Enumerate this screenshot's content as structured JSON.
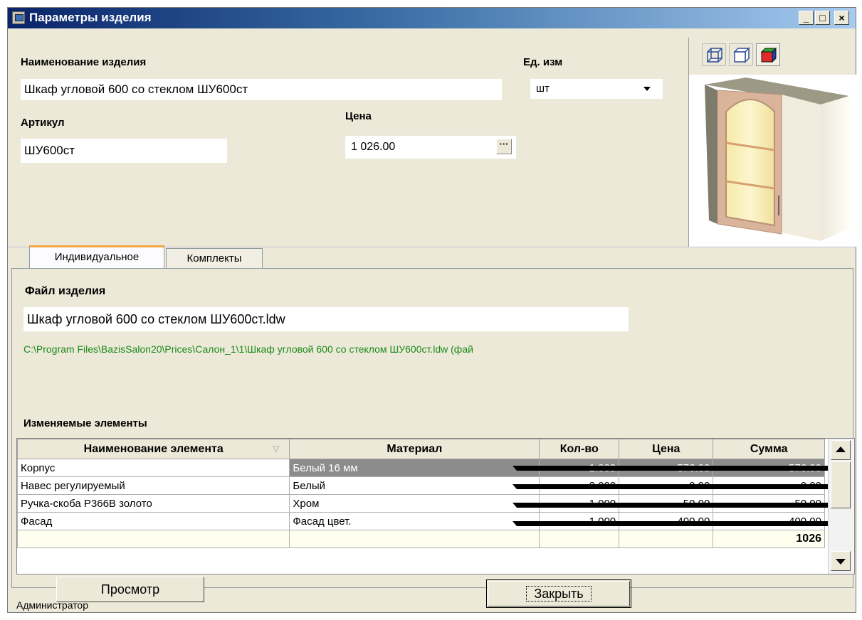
{
  "window": {
    "title": "Параметры изделия",
    "minimize_label": "_",
    "maximize_label": "□",
    "close_label": "×"
  },
  "product": {
    "name_label": "Наименование изделия",
    "name_value": "Шкаф угловой 600 со стеклом ШУ600ст",
    "unit_label": "Ед. изм",
    "unit_value": "шт",
    "article_label": "Артикул",
    "article_value": "ШУ600ст",
    "price_label": "Цена",
    "price_value": "1 026.00",
    "price_button_label": "···"
  },
  "preview": {
    "view_buttons": [
      "wireframe-view",
      "outline-view",
      "shaded-view"
    ]
  },
  "tabs": [
    {
      "label": "Индивидуальное",
      "active": true
    },
    {
      "label": "Комплекты",
      "active": false
    }
  ],
  "file": {
    "label": "Файл изделия",
    "name": "Шкаф угловой 600 со стеклом ШУ600ст.ldw",
    "path": "C:\\Program Files\\BazisSalon20\\Prices\\Салон_1\\1\\Шкаф угловой 600 со стеклом ШУ600ст.ldw (фай"
  },
  "elements": {
    "group_title": "Изменяемые элементы",
    "columns": [
      "Наименование элемента",
      "Материал",
      "Кол-во",
      "Цена",
      "Сумма"
    ],
    "rows": [
      {
        "name": "Корпус",
        "material": "Белый 16 мм",
        "qty": "1.000",
        "price": "576.00",
        "sum": "576.00"
      },
      {
        "name": "Навес регулируемый",
        "material": "Белый",
        "qty": "2.000",
        "price": "0.00",
        "sum": "0.00"
      },
      {
        "name": "Ручка-скоба Р366В золото",
        "material": "Хром",
        "qty": "1.000",
        "price": "50.00",
        "sum": "50.00"
      },
      {
        "name": "Фасад",
        "material": "Фасад цвет.",
        "qty": "1.000",
        "price": "400.00",
        "sum": "400.00"
      }
    ],
    "total": "1026"
  },
  "buttons": {
    "preview": "Просмотр",
    "close": "Закрыть"
  },
  "status": {
    "user": "Администратор"
  },
  "colors": {
    "title_gradient_start": "#0a246a",
    "path_green": "#1a8a1a",
    "selected_row": "#8c8c8c",
    "tab_accent": "#f5a442"
  }
}
